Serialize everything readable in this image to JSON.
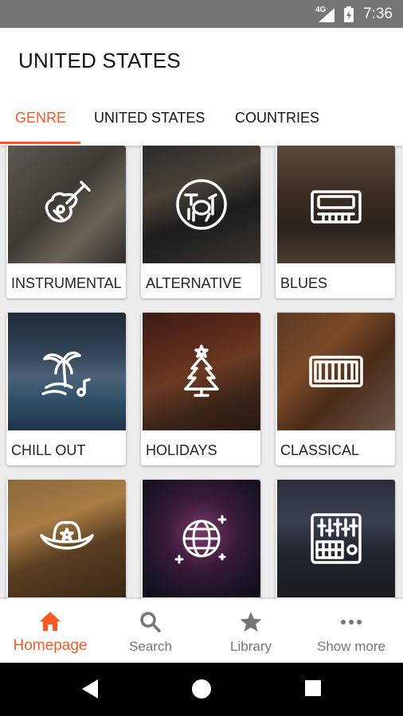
{
  "status": {
    "network": "4G",
    "time": "7:36"
  },
  "header": {
    "title": "UNITED STATES"
  },
  "tabs": [
    {
      "label": "GENRE",
      "active": true
    },
    {
      "label": "UNITED STATES",
      "active": false
    },
    {
      "label": "COUNTRIES",
      "active": false
    }
  ],
  "genres": [
    {
      "label": "INSTRUMENTAL",
      "icon": "guitar-icon"
    },
    {
      "label": "ALTERNATIVE",
      "icon": "drum-kit-icon"
    },
    {
      "label": "BLUES",
      "icon": "cassette-icon"
    },
    {
      "label": "CHILL OUT",
      "icon": "palm-tree-icon"
    },
    {
      "label": "HOLIDAYS",
      "icon": "christmas-tree-icon"
    },
    {
      "label": "CLASSICAL",
      "icon": "piano-keyboard-icon"
    },
    {
      "label": "",
      "icon": "cowboy-hat-icon"
    },
    {
      "label": "",
      "icon": "disco-ball-icon"
    },
    {
      "label": "",
      "icon": "mixer-console-icon"
    }
  ],
  "bottom_nav": [
    {
      "label": "Homepage",
      "icon": "home-icon",
      "active": true
    },
    {
      "label": "Search",
      "icon": "search-icon",
      "active": false
    },
    {
      "label": "Library",
      "icon": "star-icon",
      "active": false
    },
    {
      "label": "Show more",
      "icon": "more-dots-icon",
      "active": false
    }
  ],
  "colors": {
    "accent": "#ff5722",
    "inactive": "#757575",
    "statusbar": "#757575"
  }
}
